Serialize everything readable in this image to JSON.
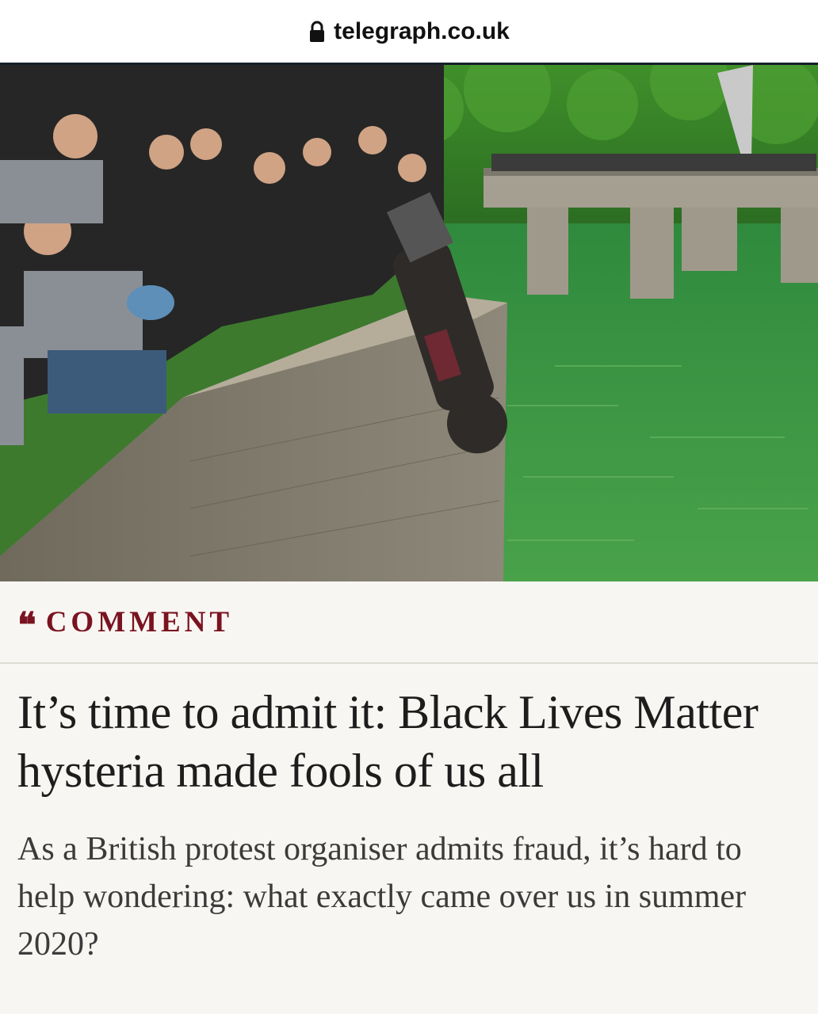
{
  "browser": {
    "url": "telegraph.co.uk",
    "lock_icon": "lock-icon"
  },
  "hero": {
    "image": "photo of protesters toppling a statue into a harbour"
  },
  "article": {
    "section_icon": "quote-marks-icon",
    "section_label": "COMMENT",
    "headline": "It’s time to admit it: Black Lives Matter hysteria made fools of us all",
    "standfirst": "As a British protest organiser admits fraud, it’s hard to help wondering: what exactly came over us in summer 2020?"
  },
  "colors": {
    "accent": "#7a1320",
    "background": "#f8f6f2",
    "urlbar_border": "#16202b"
  }
}
